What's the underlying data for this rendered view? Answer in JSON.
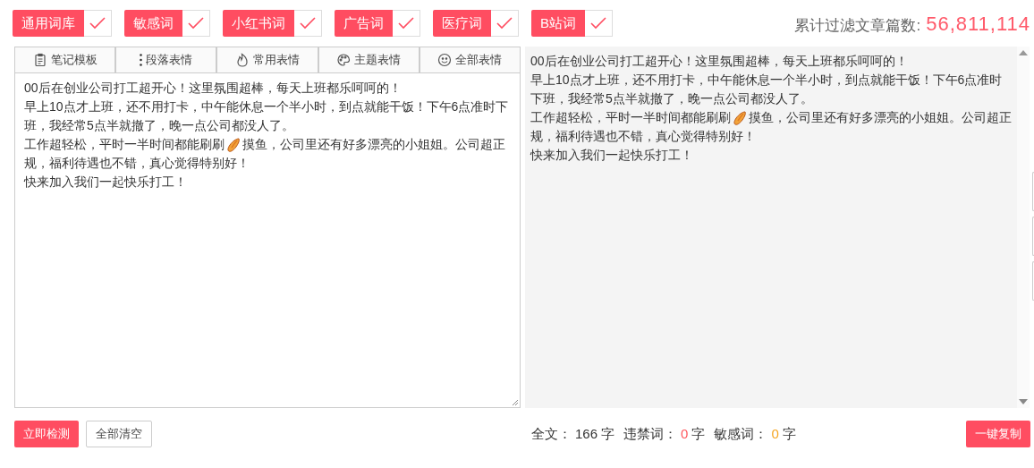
{
  "filters": [
    {
      "label": "通用词库",
      "checked": true
    },
    {
      "label": "敏感词",
      "checked": true
    },
    {
      "label": "小红书词",
      "checked": true
    },
    {
      "label": "广告词",
      "checked": true
    },
    {
      "label": "医疗词",
      "checked": true
    },
    {
      "label": "B站词",
      "checked": true
    }
  ],
  "counter": {
    "label": "累计过滤文章篇数:",
    "value": "56,811,114"
  },
  "toolbar": [
    {
      "label": "笔记模板"
    },
    {
      "label": "段落表情"
    },
    {
      "label": "常用表情"
    },
    {
      "label": "主题表情"
    },
    {
      "label": "全部表情"
    }
  ],
  "editor": {
    "paragraphs": [
      {
        "kind": "text",
        "text": "00后在创业公司打工超开心！这里氛围超棒，每天上班都乐呵呵的！"
      },
      {
        "kind": "text",
        "text": "早上10点才上班，还不用打卡，中午能休息一个半小时，到点就能干饭！下午6点准时下班，我经常5点半就撤了，晚一点公司都没人了。"
      },
      {
        "kind": "emoji",
        "before": "工作超轻松，平时一半时间都能刷刷",
        "after": "摸鱼，公司里还有好多漂亮的小姐姐。公司超正",
        "next_line": "规，福利待遇也不错，真心觉得特别好！"
      },
      {
        "kind": "text",
        "text": "快来加入我们一起快乐打工！"
      }
    ]
  },
  "preview": {
    "paragraphs": [
      {
        "kind": "text",
        "text": "00后在创业公司打工超开心！这里氛围超棒，每天上班都乐呵呵的！"
      },
      {
        "kind": "text",
        "text": "早上10点才上班，还不用打卡，中午能休息一个半小时，到点就能干饭！下午6点准时下班，我经常5点半就撤了，晚一点公司都没人了。"
      },
      {
        "kind": "emoji",
        "before": "工作超轻松，平时一半时间都能刷刷",
        "after": "摸鱼，公司里还有好多漂亮的小姐姐。公司超正",
        "next_line": "规，福利待遇也不错，真心觉得特别好！"
      },
      {
        "kind": "text",
        "text": "快来加入我们一起快乐打工！"
      }
    ]
  },
  "actions": {
    "check": "立即检测",
    "clear": "全部清空",
    "copy": "一键复制"
  },
  "stats": [
    {
      "label": "全文：",
      "value": "166",
      "unit": "字",
      "color": "#333333"
    },
    {
      "label": "违禁词：",
      "value": "0",
      "unit": "字",
      "color": "#ff5a5f"
    },
    {
      "label": "敏感词：",
      "value": "0",
      "unit": "字",
      "color": "#f5a623"
    }
  ]
}
